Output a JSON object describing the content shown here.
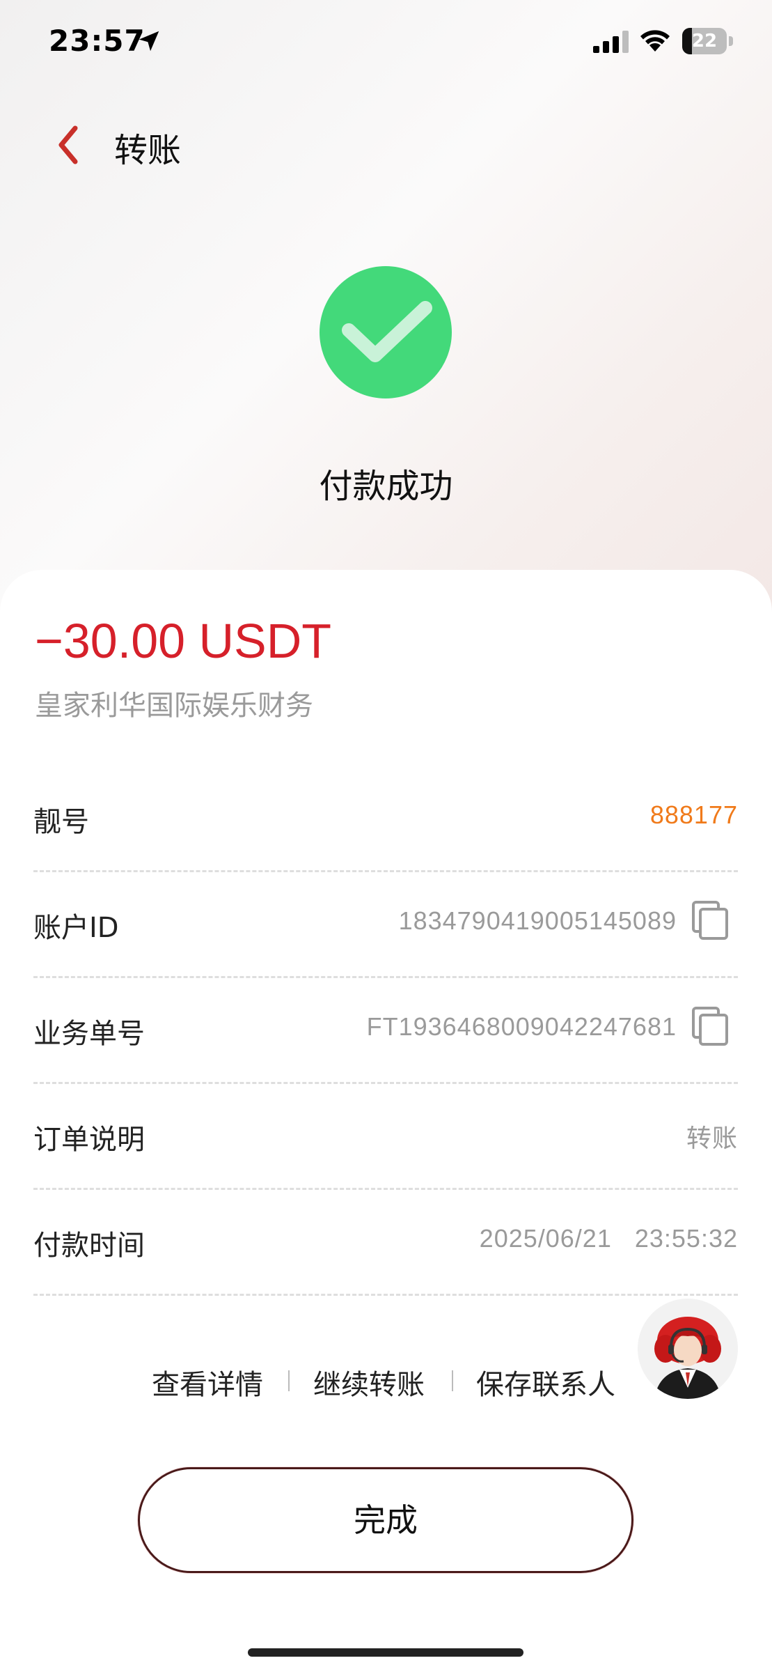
{
  "status_bar": {
    "time": "23:57",
    "battery": "22",
    "battery_level": 0.22
  },
  "nav": {
    "title": "转账"
  },
  "result": {
    "title": "付款成功"
  },
  "amount": "−30.00 USDT",
  "payee": "皇家利华国际娱乐财务",
  "rows": [
    {
      "label": "靓号",
      "value": "888177"
    },
    {
      "label": "账户ID",
      "value": "1834790419005145089"
    },
    {
      "label": "业务单号",
      "value": "FT1936468009042247681"
    },
    {
      "label": "订单说明",
      "value": "转账"
    },
    {
      "label": "付款时间",
      "value": "2025/06/21   23:55:32"
    }
  ],
  "actions": {
    "view_details": "查看详情",
    "continue_transfer": "继续转账",
    "save_contact": "保存联系人"
  },
  "done_label": "完成",
  "colors": {
    "amount": "#d6202a",
    "highlight_value": "#f07a1a",
    "success": "#43d97a",
    "back_arrow": "#c8302a"
  },
  "icons": {
    "back": "chevron-left-icon",
    "success": "check-circle-icon",
    "copy": "copy-icon",
    "support": "customer-service-avatar"
  }
}
